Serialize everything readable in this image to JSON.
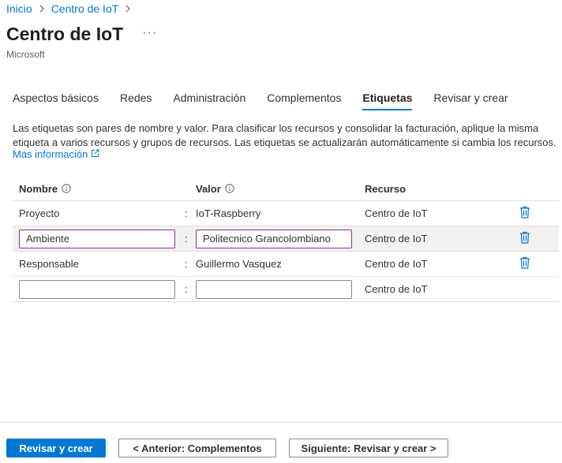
{
  "breadcrumb": [
    {
      "label": "Inicio"
    },
    {
      "label": "Centro de IoT"
    }
  ],
  "header": {
    "title": "Centro de IoT",
    "more_label": "···",
    "subtitle": "Microsoft"
  },
  "tabs": [
    {
      "label": "Aspectos básicos",
      "active": false
    },
    {
      "label": "Redes",
      "active": false
    },
    {
      "label": "Administración",
      "active": false
    },
    {
      "label": "Complementos",
      "active": false
    },
    {
      "label": "Etiquetas",
      "active": true
    },
    {
      "label": "Revisar y crear",
      "active": false
    }
  ],
  "description": "Las etiquetas son pares de nombre y valor. Para clasificar los recursos y consolidar la facturación, aplique la misma etiqueta a varios recursos y grupos de recursos. Las etiquetas se actualizarán automáticamente si cambia los recursos.",
  "more_info_link": "Más información",
  "grid": {
    "columns": {
      "name": "Nombre",
      "value": "Valor",
      "resource": "Recurso"
    },
    "separator": ":",
    "rows": [
      {
        "name": "Proyecto",
        "value": "IoT-Raspberry",
        "resource": "Centro de IoT"
      },
      {
        "name": "Ambiente",
        "value": "Politecnico Grancolombiano",
        "resource": "Centro de IoT"
      },
      {
        "name": "Responsable",
        "value": "Guillermo Vasquez",
        "resource": "Centro de IoT"
      },
      {
        "name": "",
        "value": "",
        "resource": "Centro de IoT"
      }
    ]
  },
  "footer": {
    "primary_label": "Revisar y crear",
    "prev_label": "< Anterior: Complementos",
    "next_label": "Siguiente: Revisar y crear >"
  },
  "colors": {
    "accent": "#0078d4",
    "focus_border": "#8a2fa8",
    "selected_row": "#f3f2f1",
    "text": "#323130"
  },
  "icons": {
    "breadcrumb_sep": "chevron-right-icon",
    "more": "more-icon",
    "info": "info-icon",
    "external": "external-link-icon",
    "delete": "trash-icon"
  }
}
